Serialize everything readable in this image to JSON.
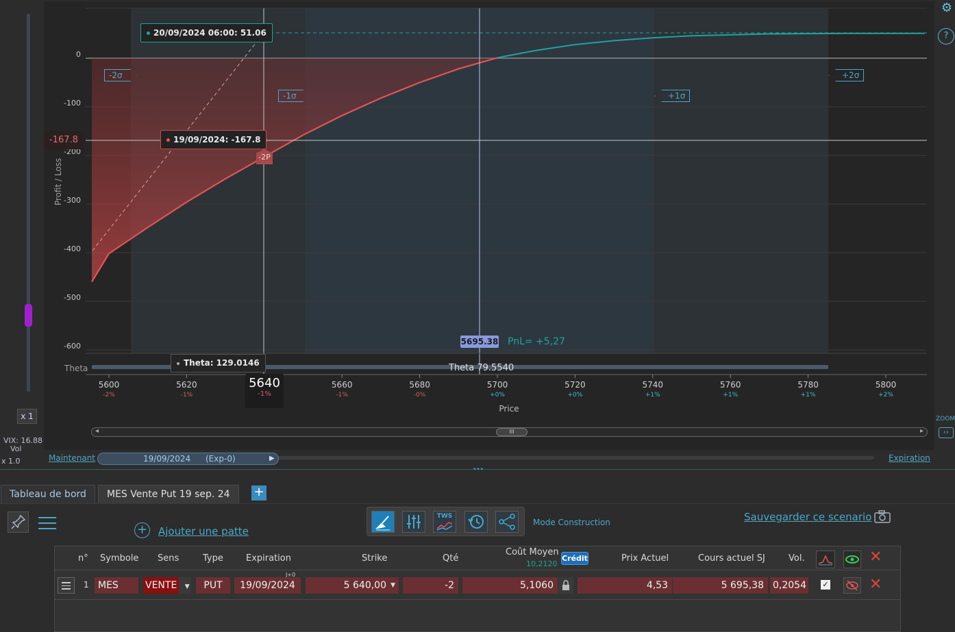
{
  "chart": {
    "ylabel": "Profit / Loss",
    "xlabel": "Price",
    "theta_label": "Theta",
    "y_ticks": [
      "0",
      "-100",
      "-200",
      "-300",
      "-400",
      "-500",
      "-600"
    ],
    "x_ticks": [
      "5600",
      "5620",
      "5640",
      "5660",
      "5680",
      "5700",
      "5720",
      "5740",
      "5760",
      "5780",
      "5800"
    ],
    "x_pct": [
      "-2%",
      "-1%",
      "-1%",
      "-1%",
      "-0%",
      "+0%",
      "+0%",
      "+1%",
      "+1%",
      "+1%",
      "+2%"
    ],
    "sigma_labels": [
      "-2σ",
      "-1σ",
      "+1σ",
      "+2σ"
    ],
    "tooltip_exp": "20/09/2024 06:00: 51.06",
    "tooltip_now": "19/09/2024: -167.8",
    "y_marker": "-167.8",
    "leg_marker": "-2P",
    "theta_tooltip": "Theta: 129.0146",
    "theta_center": "Theta 79.5540",
    "current_price": "5695.38",
    "pnl": "PnL= +5,27",
    "cursor_price": "5640",
    "cursor_pct": "-1%"
  },
  "chart_data": {
    "type": "line",
    "xlabel": "Price",
    "ylabel": "Profit / Loss",
    "xlim": [
      5595,
      5810
    ],
    "ylim": [
      -600,
      10
    ],
    "series": [
      {
        "name": "19/09/2024",
        "x": [
          5590,
          5600,
          5610,
          5620,
          5630,
          5640,
          5650,
          5660,
          5670,
          5680,
          5690,
          5700,
          5710,
          5720,
          5730,
          5740,
          5750,
          5760,
          5770,
          5780,
          5790,
          5800,
          5810
        ],
        "y": [
          -460,
          -402,
          -348,
          -296,
          -248,
          -203,
          -158,
          -118,
          -82,
          -50,
          -22,
          1,
          16,
          28,
          36,
          42,
          46,
          48,
          50,
          50.5,
          51,
          51,
          51
        ]
      },
      {
        "name": "20/09/2024 06:00",
        "x": [
          5590,
          5640,
          5810
        ],
        "y": [
          -395,
          51.06,
          51.06
        ]
      }
    ]
  },
  "left": {
    "zoom_mult": "x 1",
    "vix": "VIX: 16.88",
    "vol": "Vol",
    "vol_mult": "x 1.0"
  },
  "right": {
    "settings_icon": "gear-icon",
    "help": "?",
    "zoom": "ZOOM"
  },
  "timeline": {
    "now": "Maintenant",
    "date": "19/09/2024",
    "exp": "(Exp-0)",
    "expiration": "Expiration"
  },
  "tabs": [
    {
      "label": "Tableau de bord"
    },
    {
      "label": "MES Vente Put 19 sep. 24"
    }
  ],
  "add_tab": "+",
  "toolbar": {
    "add_leg": "Ajouter une patte",
    "mode": "Mode Construction",
    "save": "Sauvegarder ce scenario",
    "tws": "TWS"
  },
  "table": {
    "headers": {
      "n": "n°",
      "symbol": "Symbole",
      "side": "Sens",
      "type": "Type",
      "expiration": "Expiration",
      "strike": "Strike",
      "qty": "Qté",
      "avg_cost": "Coût Moyen",
      "avg_cost_sub": "10,2120",
      "credit": "Crédit",
      "price": "Prix Actuel",
      "underlying": "Cours actuel SJ",
      "vol": "Vol.",
      "j0": "J+0"
    },
    "row": {
      "n": "1",
      "symbol": "MES",
      "side": "VENTE",
      "type": "PUT",
      "expiration": "19/09/2024",
      "strike": "5 640,00",
      "qty": "-2",
      "avg_cost": "5,1060",
      "price": "4,53",
      "underlying": "5 695,38",
      "vol": "0,2054",
      "checked": "✓"
    }
  },
  "colors": {
    "now_curve": "#e05555",
    "exp_curve": "#1fa39a",
    "accent": "#4aa8c8"
  }
}
